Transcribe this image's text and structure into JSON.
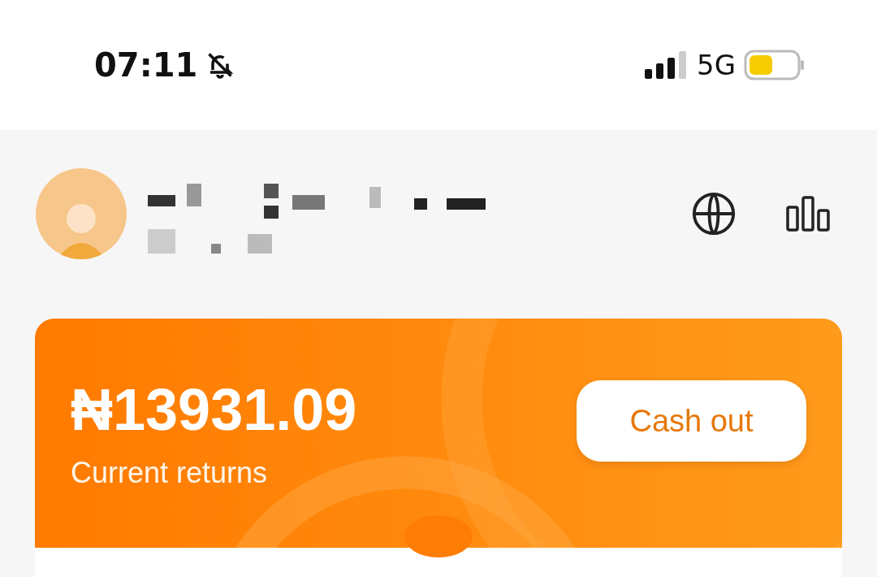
{
  "status_bar": {
    "time": "07:11",
    "network": "5G"
  },
  "balance_card": {
    "amount": "₦13931.09",
    "caption": "Current returns",
    "button": "Cash out"
  }
}
